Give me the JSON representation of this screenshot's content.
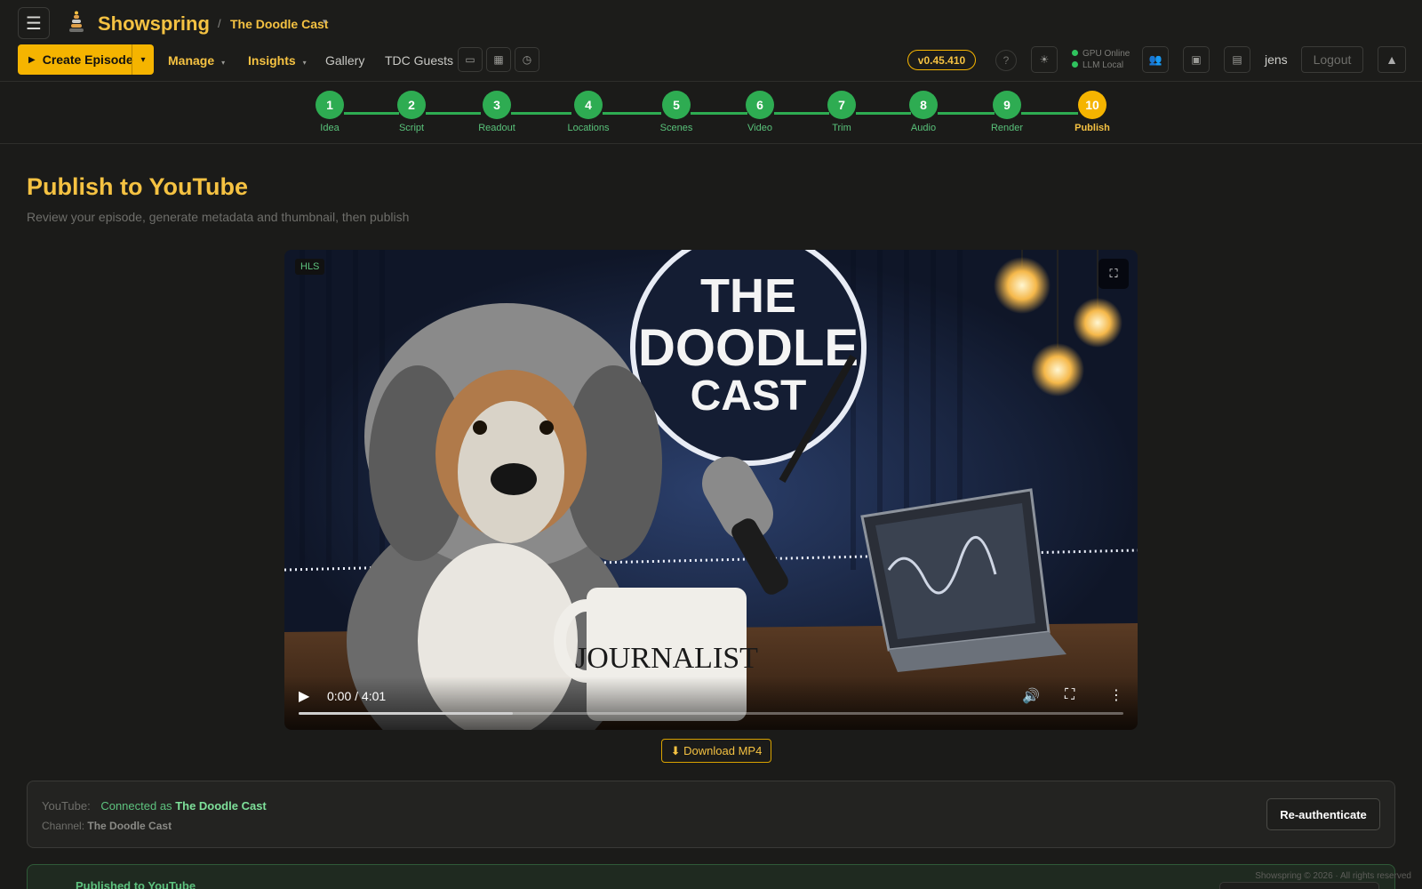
{
  "header": {
    "menu_icon": "hamburger-icon",
    "brand": "Showspring",
    "breadcrumb_sep": "/",
    "project": "The Doodle Cast",
    "create_episode": "Create Episode",
    "nav": {
      "manage": "Manage",
      "insights": "Insights",
      "gallery": "Gallery",
      "guests": "TDC Guests"
    },
    "version": "v0.45.410",
    "help": "?",
    "status": {
      "gpu": "GPU Online",
      "llm": "LLM Local"
    },
    "username": "jens",
    "logout": "Logout",
    "colors": {
      "accent": "#f5b400",
      "success": "#2eac52"
    }
  },
  "steps": [
    {
      "num": "1",
      "label": "Idea"
    },
    {
      "num": "2",
      "label": "Script"
    },
    {
      "num": "3",
      "label": "Readout"
    },
    {
      "num": "4",
      "label": "Locations"
    },
    {
      "num": "5",
      "label": "Scenes"
    },
    {
      "num": "6",
      "label": "Video"
    },
    {
      "num": "7",
      "label": "Trim"
    },
    {
      "num": "8",
      "label": "Audio"
    },
    {
      "num": "9",
      "label": "Render"
    },
    {
      "num": "10",
      "label": "Publish"
    }
  ],
  "main": {
    "title": "Publish to YouTube",
    "subtitle": "Review your episode, generate metadata and thumbnail, then publish",
    "video": {
      "badge": "HLS",
      "sign_line1": "THE",
      "sign_line2": "DOODLE",
      "sign_line3": "CAST",
      "mug_text": "JOURNALIST",
      "time": "0:00 / 4:01",
      "progress": 0.26
    },
    "download": "⬇ Download MP4"
  },
  "youtube": {
    "label": "YouTube:",
    "connected_prefix": "Connected as",
    "connected_name": "The Doodle Cast",
    "channel_label": "Channel:",
    "channel_name": "The Doodle Cast",
    "reauth": "Re-authenticate"
  },
  "published": {
    "title": "Published to YouTube"
  },
  "footer": "Showspring © 2026 · All rights reserved"
}
